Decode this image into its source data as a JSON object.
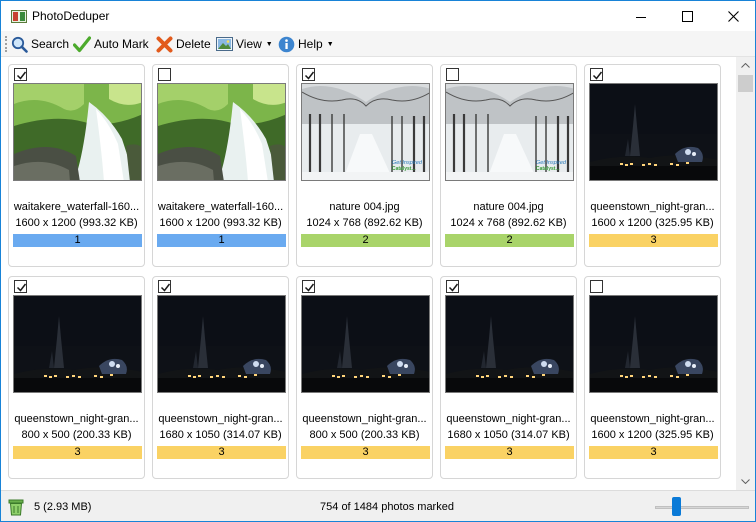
{
  "window": {
    "title": "PhotoDeduper",
    "minimize_icon": "minimize-icon",
    "maximize_icon": "maximize-icon",
    "close_icon": "close-icon"
  },
  "toolbar": {
    "search": {
      "label": "Search",
      "icon": "magnifier-icon"
    },
    "auto_mark": {
      "label": "Auto Mark",
      "icon": "checkmark-icon"
    },
    "delete": {
      "label": "Delete",
      "icon": "delete-x-icon"
    },
    "view": {
      "label": "View",
      "icon": "picture-icon"
    },
    "help": {
      "label": "Help",
      "icon": "info-icon"
    }
  },
  "group_colors": {
    "1": "#6aaaf0",
    "2": "#a9d46a",
    "3": "#fad264"
  },
  "photos": [
    {
      "checked": true,
      "filename": "waitakere_waterfall-160...",
      "size": "1600 x 1200 (993.32 KB)",
      "group": "1",
      "image": "waterfall"
    },
    {
      "checked": false,
      "filename": "waitakere_waterfall-160...",
      "size": "1600 x 1200 (993.32 KB)",
      "group": "1",
      "image": "waterfall"
    },
    {
      "checked": true,
      "filename": "nature 004.jpg",
      "size": "1024 x 768 (892.62 KB)",
      "group": "2",
      "image": "snow"
    },
    {
      "checked": false,
      "filename": "nature 004.jpg",
      "size": "1024 x 768 (892.62 KB)",
      "group": "2",
      "image": "snow"
    },
    {
      "checked": true,
      "filename": "queenstown_night-gran...",
      "size": "1600 x 1200 (325.95 KB)",
      "group": "3",
      "image": "night"
    },
    {
      "checked": true,
      "filename": "queenstown_night-gran...",
      "size": "800 x 500 (200.33 KB)",
      "group": "3",
      "image": "night"
    },
    {
      "checked": true,
      "filename": "queenstown_night-gran...",
      "size": "1680 x 1050 (314.07 KB)",
      "group": "3",
      "image": "night"
    },
    {
      "checked": true,
      "filename": "queenstown_night-gran...",
      "size": "800 x 500 (200.33 KB)",
      "group": "3",
      "image": "night"
    },
    {
      "checked": true,
      "filename": "queenstown_night-gran...",
      "size": "1680 x 1050 (314.07 KB)",
      "group": "3",
      "image": "night"
    },
    {
      "checked": false,
      "filename": "queenstown_night-gran...",
      "size": "1600 x 1200 (325.95 KB)",
      "group": "3",
      "image": "night"
    }
  ],
  "snow_watermark": {
    "line1": "Get Inspired",
    "line2": "Catalyst..."
  },
  "status": {
    "count": "5 (2.93 MB)",
    "marked": "754 of 1484 photos marked",
    "zoom_level": 0.2
  }
}
